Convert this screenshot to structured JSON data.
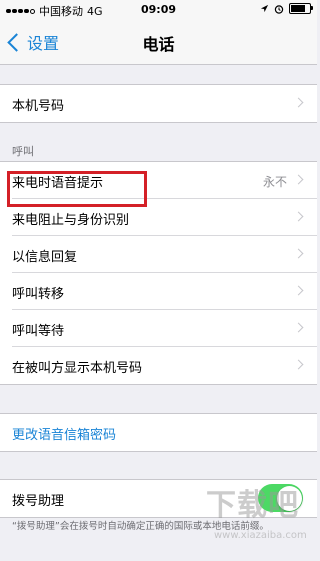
{
  "status_bar": {
    "carrier": "中国移动",
    "network": "4G",
    "time": "09:09",
    "battery_level": 0.9
  },
  "nav": {
    "back_label": "设置",
    "title": "电话"
  },
  "section1": {
    "rows": [
      {
        "label": "本机号码"
      }
    ]
  },
  "section2": {
    "header": "呼叫",
    "rows": [
      {
        "label": "来电时语音提示",
        "value": "永不"
      },
      {
        "label": "来电阻止与身份识别"
      },
      {
        "label": "以信息回复"
      },
      {
        "label": "呼叫转移"
      },
      {
        "label": "呼叫等待"
      },
      {
        "label": "在被叫方显示本机号码"
      }
    ]
  },
  "section3": {
    "link_label": "更改语音信箱密码"
  },
  "section4": {
    "toggle_label": "拨号助理",
    "toggle_on": true,
    "footer": "“拨号助理”会在拨号时自动确定正确的国际或本地电话前缀。"
  },
  "watermark": {
    "text": "下载吧",
    "url": "www.xiazaiba.com"
  },
  "colors": {
    "accent": "#1a84d6",
    "toggle_on": "#4cd964",
    "highlight": "#d42027"
  }
}
